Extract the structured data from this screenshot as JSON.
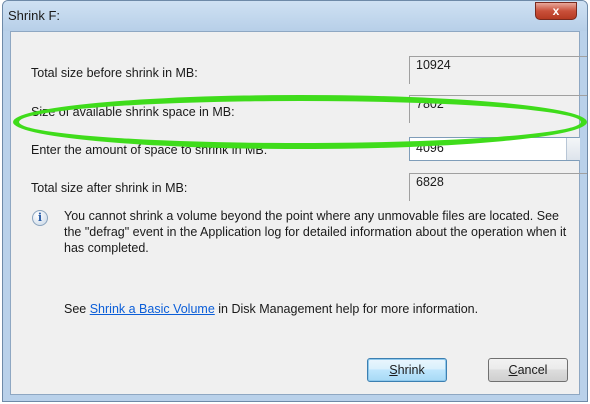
{
  "window": {
    "title": "Shrink F:",
    "close_glyph": "x"
  },
  "rows": {
    "total_before": {
      "label": "Total size before shrink in MB:",
      "value": "10924"
    },
    "available": {
      "label": "Size of available shrink space in MB:",
      "value": "7802"
    },
    "amount": {
      "label": "Enter the amount of space to shrink in MB:",
      "value": "4096"
    },
    "total_after": {
      "label": "Total size after shrink in MB:",
      "value": "6828"
    }
  },
  "info": {
    "icon": "info-icon",
    "text": "You cannot shrink a volume beyond the point where any unmovable files are located. See the \"defrag\" event in the Application log for detailed information about the operation when it has completed."
  },
  "help": {
    "prefix": "See ",
    "link_text": "Shrink a Basic Volume",
    "suffix": " in Disk Management help for more information."
  },
  "buttons": {
    "shrink": {
      "mnemonic": "S",
      "rest": "hrink"
    },
    "cancel": {
      "mnemonic": "C",
      "rest": "ancel"
    }
  },
  "colors": {
    "highlight": "#3fdc1b",
    "link": "#0b5ed8"
  }
}
